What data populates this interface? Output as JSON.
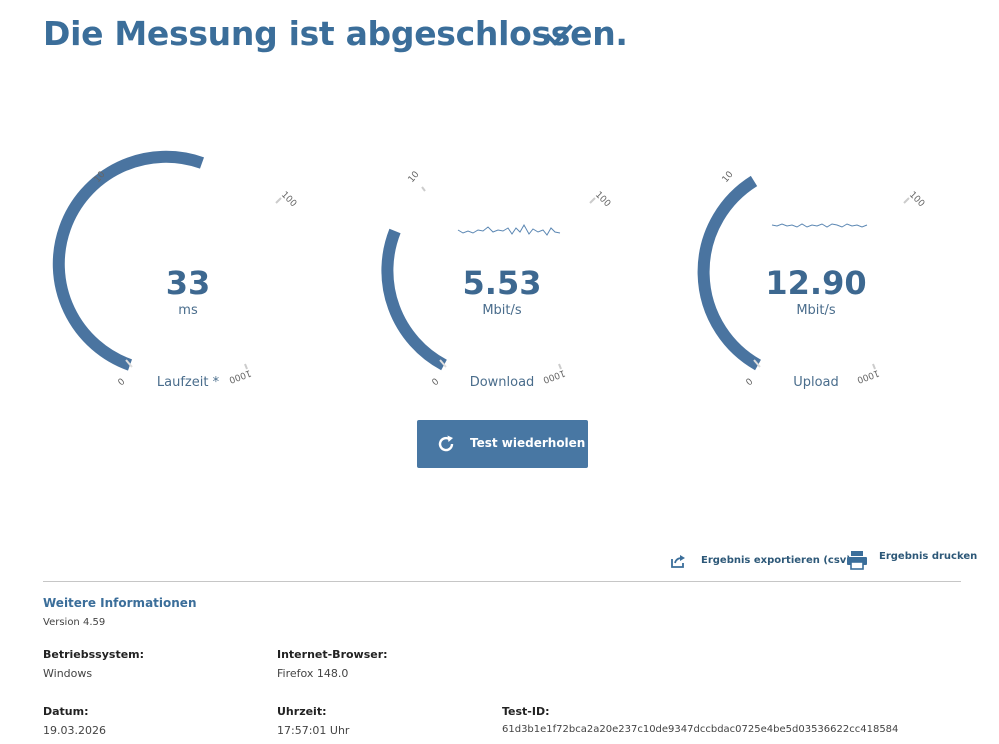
{
  "header": {
    "title": "Die Messung ist abgeschlossen."
  },
  "gauges": [
    {
      "value": "33",
      "unit": "ms",
      "label": "Laufzeit *",
      "tick_min": "0",
      "tick_mid": "10",
      "tick_hi": "100",
      "tick_max": "1000"
    },
    {
      "value": "5.53",
      "unit": "Mbit/s",
      "label": "Download",
      "tick_min": "0",
      "tick_mid": "10",
      "tick_hi": "100",
      "tick_max": "1000"
    },
    {
      "value": "12.90",
      "unit": "Mbit/s",
      "label": "Upload",
      "tick_min": "0",
      "tick_mid": "10",
      "tick_hi": "100",
      "tick_max": "1000"
    }
  ],
  "retest": {
    "label": "Test wiederholen"
  },
  "actions": {
    "export_label": "Ergebnis exportieren (csv)",
    "print_label": "Ergebnis drucken"
  },
  "info": {
    "heading": "Weitere Informationen",
    "version": "Version 4.59",
    "os_label": "Betriebssystem:",
    "os_value": "Windows",
    "browser_label": "Internet-Browser:",
    "browser_value": "Firefox 148.0",
    "date_label": "Datum:",
    "date_value": "19.03.2026",
    "time_label": "Uhrzeit:",
    "time_value": "17:57:01 Uhr",
    "testid_label": "Test-ID:",
    "testid_value": "61d3b1e1f72bca2a20e237c10de9347dccbdac0725e4be5d03536622cc418584"
  },
  "colors": {
    "accent": "#4877a3",
    "title": "#3b6e9a",
    "track": "#4a74a0"
  }
}
